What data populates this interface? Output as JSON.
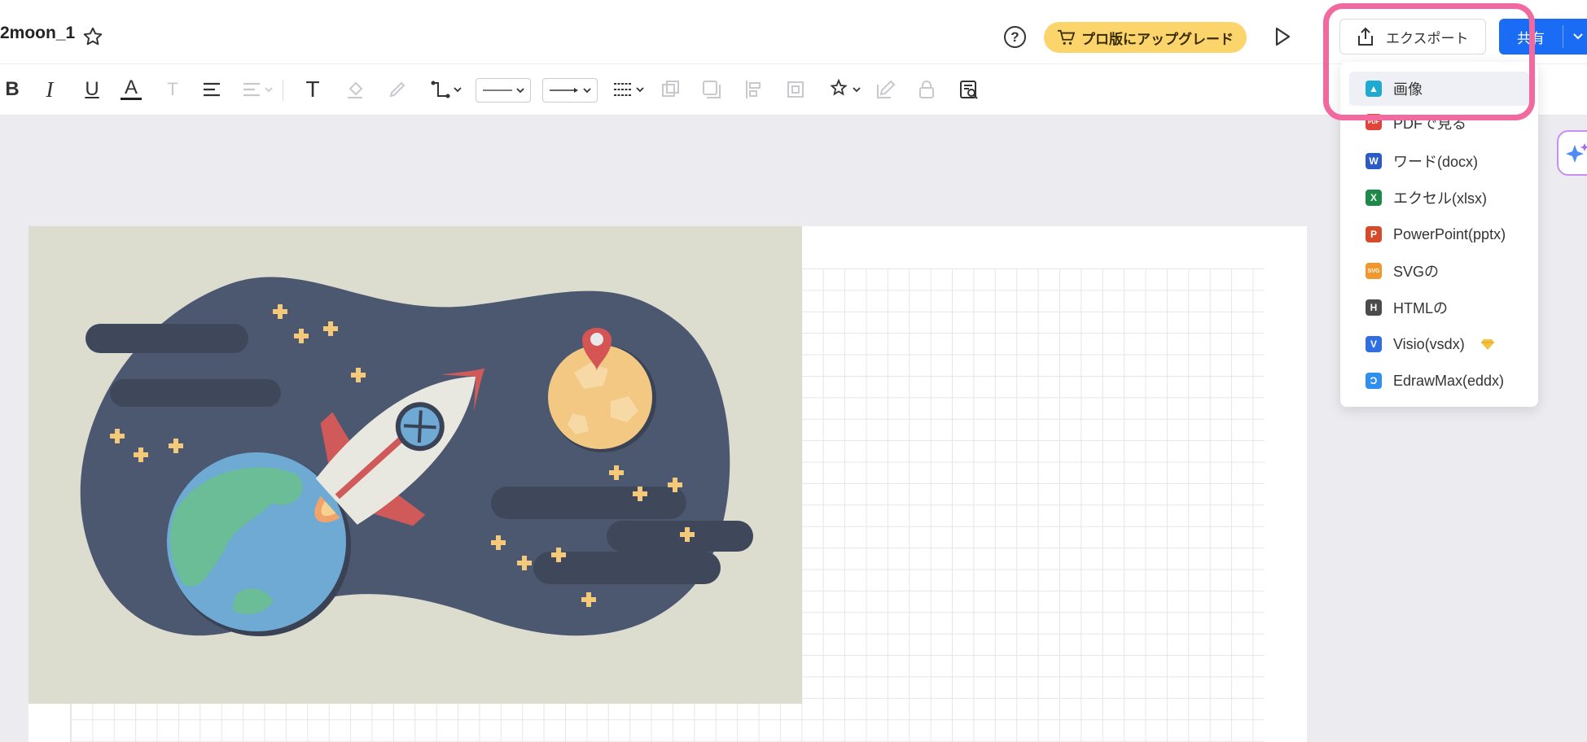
{
  "header": {
    "doc_title": "2moon_1",
    "upgrade_label": "プロ版にアップグレード",
    "export_label": "エクスポート",
    "share_label": "共有"
  },
  "icons": {
    "star": "star-icon",
    "help": "help-icon",
    "cart": "cart-icon",
    "play": "play-icon",
    "export": "export-icon",
    "chevron": "chevron-down-icon",
    "ai": "ai-sparkle-icon"
  },
  "toolbar": {
    "bold": "B",
    "italic": "I",
    "underline": "U",
    "font_color": "A",
    "text_style": "T",
    "text": "T"
  },
  "help_glyph": "?",
  "export_menu": {
    "items": [
      {
        "label": "画像",
        "icon": "image-icon",
        "color": "#1eaad1",
        "glyph": "▲"
      },
      {
        "label": "PDFで見る",
        "icon": "pdf-icon",
        "color": "#e0443a",
        "glyph": "PDF"
      },
      {
        "label": "ワード(docx)",
        "icon": "word-icon",
        "color": "#2b5cc5",
        "glyph": "W"
      },
      {
        "label": "エクセル(xlsx)",
        "icon": "excel-icon",
        "color": "#1e8a4a",
        "glyph": "X"
      },
      {
        "label": "PowerPoint(pptx)",
        "icon": "powerpoint-icon",
        "color": "#d44b2c",
        "glyph": "P"
      },
      {
        "label": "SVGの",
        "icon": "svg-icon",
        "color": "#f0982e",
        "glyph": "SVG"
      },
      {
        "label": "HTMLの",
        "icon": "html-icon",
        "color": "#4b4b4b",
        "glyph": "H"
      },
      {
        "label": "Visio(vsdx)",
        "icon": "visio-icon",
        "color": "#2f6fe4",
        "glyph": "V"
      },
      {
        "label": "EdrawMax(eddx)",
        "icon": "edrawmax-icon",
        "color": "#2f8ff0",
        "glyph": "Ɔ"
      }
    ]
  },
  "colors": {
    "accent": "#1a6cf5",
    "upgrade": "#fbd46c",
    "highlight": "#f2699f",
    "canvas_bg": "#ebebf0",
    "illustration_bg": "#dcdccf",
    "space": "#4c5870"
  }
}
